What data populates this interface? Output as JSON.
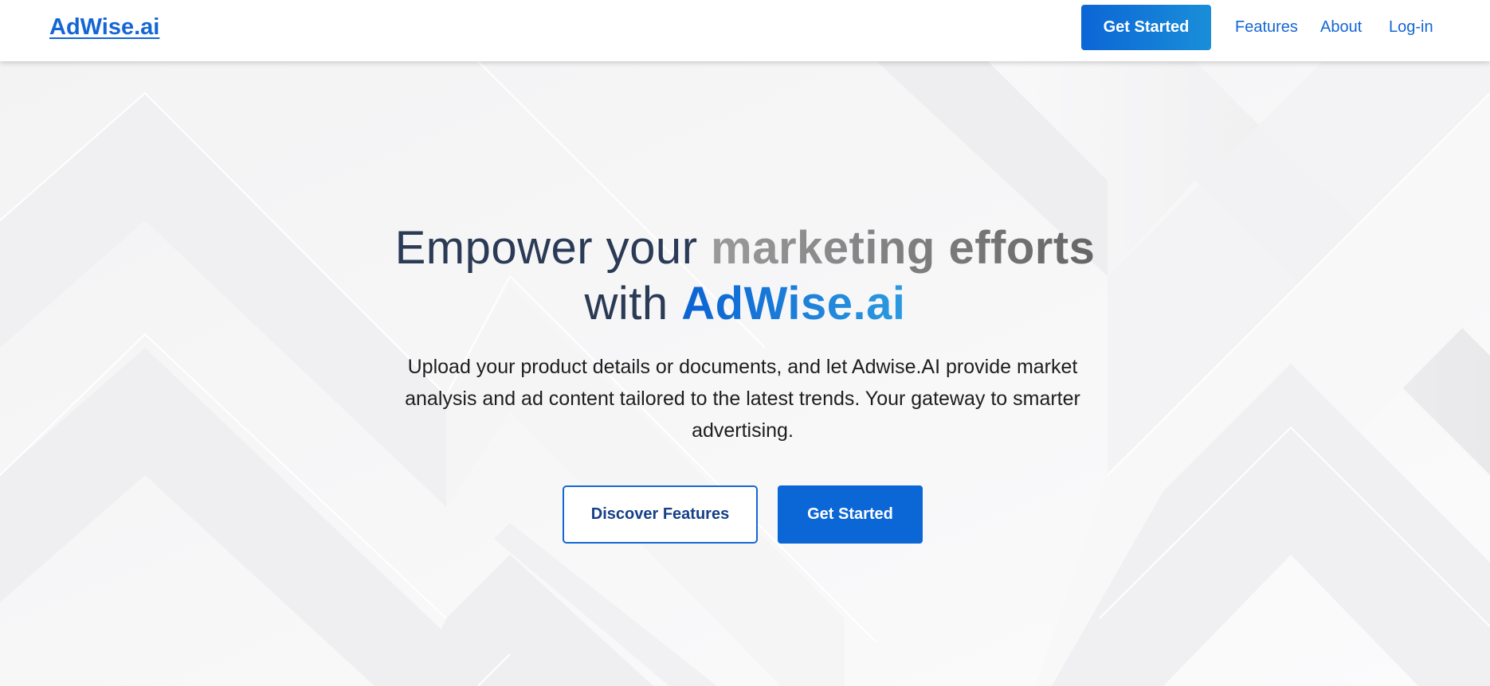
{
  "header": {
    "brand": "AdWise.ai",
    "cta_label": "Get Started",
    "nav": {
      "features": "Features",
      "about": "About",
      "login": "Log-in"
    }
  },
  "hero": {
    "headline": {
      "part1": "Empower your ",
      "part2": "marketing efforts",
      "part3": "with ",
      "part4": "AdWise.ai"
    },
    "subtext": "Upload your product details or documents, and let Adwise.AI provide market analysis and ad content tailored to the latest trends. Your gateway to smarter advertising.",
    "secondary_button": "Discover Features",
    "primary_button": "Get Started"
  },
  "colors": {
    "brand_blue": "#1466d4",
    "button_blue": "#0b66d6",
    "heading_text": "#2b3a55",
    "background": "#f6f6f7"
  }
}
